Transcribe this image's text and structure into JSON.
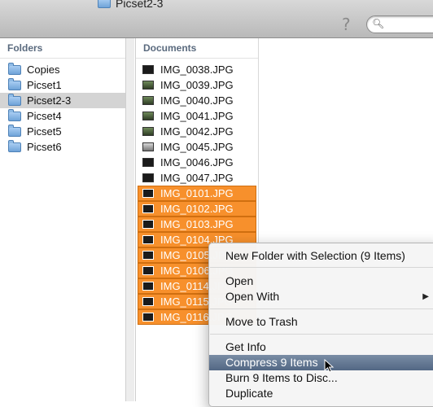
{
  "window": {
    "title": "Picset2-3"
  },
  "folders": {
    "header": "Folders",
    "items": [
      {
        "label": "Copies"
      },
      {
        "label": "Picset1"
      },
      {
        "label": "Picset2-3",
        "selected": true
      },
      {
        "label": "Picset4"
      },
      {
        "label": "Picset5"
      },
      {
        "label": "Picset6"
      }
    ]
  },
  "documents": {
    "header": "Documents",
    "items": [
      {
        "label": "IMG_0038.JPG",
        "thumb": "dark"
      },
      {
        "label": "IMG_0039.JPG",
        "thumb": "green"
      },
      {
        "label": "IMG_0040.JPG",
        "thumb": "green"
      },
      {
        "label": "IMG_0041.JPG",
        "thumb": "green"
      },
      {
        "label": "IMG_0042.JPG",
        "thumb": "green"
      },
      {
        "label": "IMG_0045.JPG",
        "thumb": "dark"
      },
      {
        "label": "IMG_0046.JPG",
        "thumb": "dark"
      },
      {
        "label": "IMG_0047.JPG",
        "thumb": "dark"
      },
      {
        "label": "IMG_0101.JPG",
        "thumb": "dark",
        "selected": true
      },
      {
        "label": "IMG_0102.JPG",
        "thumb": "dark",
        "selected": true
      },
      {
        "label": "IMG_0103.JPG",
        "thumb": "dark",
        "selected": true
      },
      {
        "label": "IMG_0104.JPG",
        "thumb": "dark",
        "selected": true
      },
      {
        "label": "IMG_0105.JPG",
        "thumb": "dark",
        "selected": true
      },
      {
        "label": "IMG_0106.JPG",
        "thumb": "dark",
        "selected": true
      },
      {
        "label": "IMG_0114.JPG",
        "thumb": "dark",
        "selected": true
      },
      {
        "label": "IMG_0115.JPG",
        "thumb": "dark",
        "selected": true
      },
      {
        "label": "IMG_0116.JPG",
        "thumb": "dark",
        "selected": true
      }
    ]
  },
  "context_menu": {
    "items": [
      {
        "label": "New Folder with Selection (9 Items)"
      },
      {
        "label": "Open"
      },
      {
        "label": "Open With",
        "submenu": true
      },
      {
        "label": "Move to Trash"
      },
      {
        "label": "Get Info"
      },
      {
        "label": "Compress 9 Items",
        "highlighted": true
      },
      {
        "label": "Burn 9 Items to Disc..."
      },
      {
        "label": "Duplicate"
      }
    ]
  },
  "icons": {
    "help": "help-icon",
    "search": "search-icon",
    "folder": "folder-icon",
    "image": "image-file-icon",
    "submenu_arrow": "chevron-right-icon",
    "cursor": "pointer-cursor-icon"
  },
  "colors": {
    "selection_orange": "#f7902c",
    "menu_highlight": "#5f7391",
    "sidebar_selected": "#d4d4d4"
  }
}
